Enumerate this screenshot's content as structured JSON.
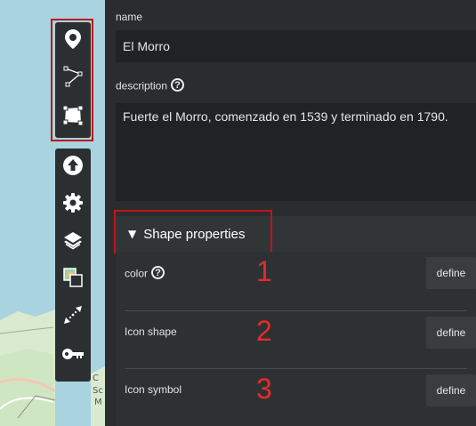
{
  "map": {
    "label_c": "C",
    "label_sc": "Sc",
    "label_m": "M"
  },
  "toolbar": {
    "draw_tools": [
      {
        "icon": "map-marker-icon"
      },
      {
        "icon": "polyline-icon"
      },
      {
        "icon": "polygon-icon"
      }
    ],
    "main_tools": [
      {
        "icon": "upload-icon"
      },
      {
        "icon": "gear-icon"
      },
      {
        "icon": "layers-icon"
      },
      {
        "icon": "tilelayer-icon"
      },
      {
        "icon": "arrows-icon"
      },
      {
        "icon": "key-icon"
      }
    ]
  },
  "form": {
    "name_label": "name",
    "name_value": "El Morro",
    "description_label": "description",
    "description_value": "Fuerte el Morro, comenzado en 1539 y terminado en 1790.",
    "help_glyph": "?"
  },
  "shape_properties": {
    "title": "Shape properties",
    "rows": [
      {
        "label": "color",
        "annotation": "1",
        "button": "define",
        "has_help": true
      },
      {
        "label": "Icon shape",
        "annotation": "2",
        "button": "define",
        "has_help": false
      },
      {
        "label": "Icon symbol",
        "annotation": "3",
        "button": "define",
        "has_help": false
      }
    ]
  },
  "colors": {
    "panel_bg": "#2a2c2e",
    "input_bg": "#202224",
    "highlight": "#c0141c",
    "annotation": "#e52b2b",
    "map_water": "#a9d3de",
    "map_land": "#d9ead0"
  }
}
